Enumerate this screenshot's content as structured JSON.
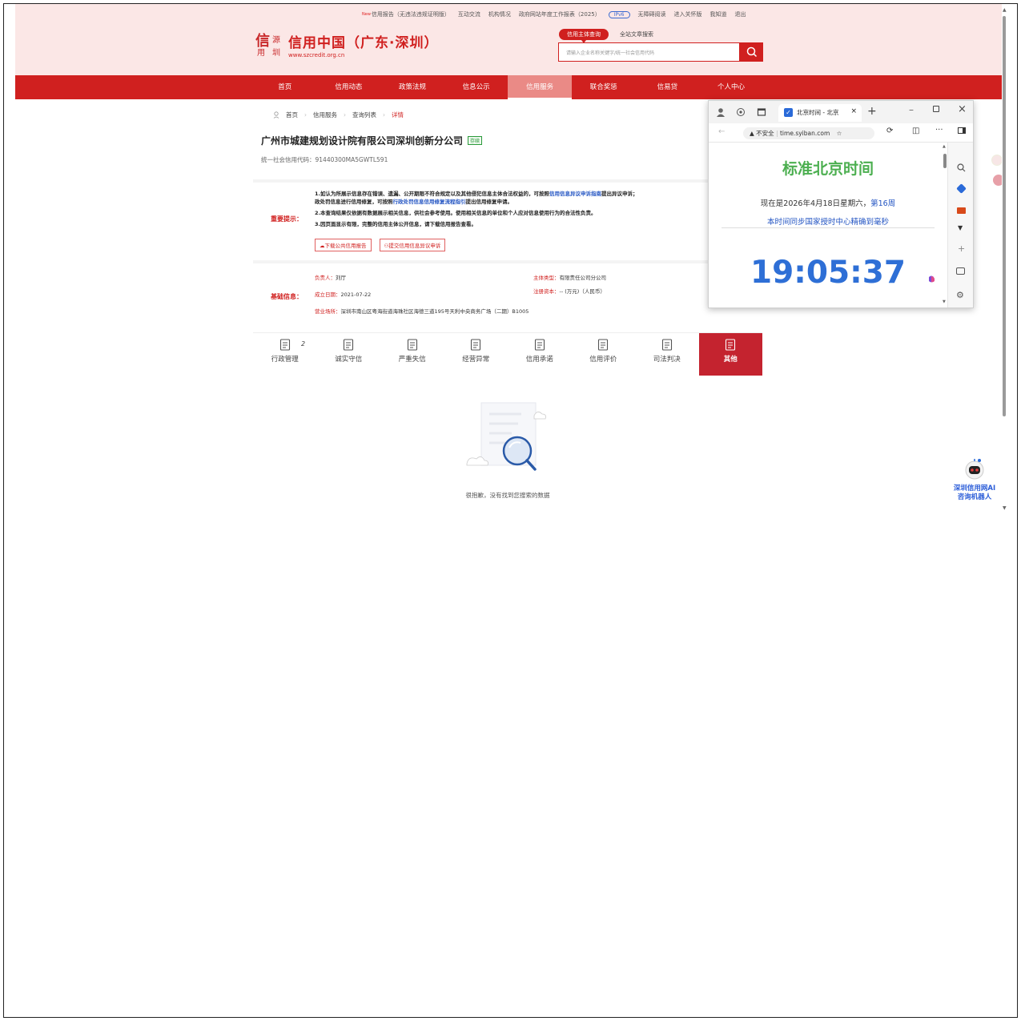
{
  "header": {
    "top_links": {
      "new_tag": "New",
      "report": "信用报告（无违法违规证明版）",
      "interact": "互动交流",
      "org": "机构情况",
      "gov_report": "政府网站年度工作报表（2025）",
      "ipv6": "IPv6",
      "barrier_free": "无障碍阅读",
      "elder": "进入关怀版",
      "login": "我知道",
      "exit": "退出"
    },
    "logo": {
      "mark_chars": [
        "信",
        "源",
        "用",
        "圳"
      ],
      "title": "信用中国（广东·深圳）",
      "url": "www.szcredit.org.cn"
    },
    "search": {
      "tab_active": "信用主体查询",
      "tab_other": "全站文章搜索",
      "placeholder": "请输入企业名称关键字/统一社会信用代码"
    }
  },
  "nav": {
    "items": [
      "首页",
      "信用动态",
      "政策法规",
      "信息公示",
      "信用服务",
      "联合奖惩",
      "信易贷",
      "个人中心"
    ],
    "active_index": 4
  },
  "breadcrumb": {
    "home": "首页",
    "service": "信用服务",
    "list": "查询列表",
    "current": "详情"
  },
  "company": {
    "name": "广州市城建规划设计院有限公司深圳创新分公司",
    "status": "存续",
    "uscc": "统一社会信用代码：91440300MA5GWTL591"
  },
  "notice": {
    "label": "重要提示：",
    "line1a": "1.如认为所展示信息存在错误、遗漏、公开期限不符合规定以及其他侵犯信息主体合法权益的，可按照",
    "line1_link": "信用信息异议申诉指南",
    "line1b": "提出异议申诉；",
    "line2a": "政处罚信息进行信用修复，可按照",
    "line2_link": "行政处罚信息信用修复流程指引",
    "line2b": "提出信用修复申请。",
    "line3": "2.本查询结果仅依据有数据展示相关信息，供社会参考使用。使用相关信息的单位和个人应对信息使用行为的合法性负责。",
    "line4": "3.因页面显示有限，完整的信用主体公开信息，请下载信用报告查看。",
    "btn_download": "下载公共信用报告",
    "btn_objection": "提交信用信息异议申诉"
  },
  "basic": {
    "label": "基础信息：",
    "leader_k": "负责人：",
    "leader_v": "刘厅",
    "type_k": "主体类型：",
    "type_v": "有限责任公司分公司",
    "date_k": "成立日期：",
    "date_v": "2021-07-22",
    "capital_k": "注册资本：",
    "capital_v": "-- (万元)（人民币）",
    "address_k": "营业场所：",
    "address_v": "深圳市南山区粤海街道海珠社区海德三道195号天利中央商务广场（二期）B1005"
  },
  "tabs": {
    "items": [
      "行政管理",
      "诚实守信",
      "严重失信",
      "经营异常",
      "信用承诺",
      "信用评价",
      "司法判决",
      "其他"
    ],
    "admin_count": "2",
    "active_index": 7
  },
  "empty": {
    "text": "很抱歉，没有找到您搜索的数据"
  },
  "popup": {
    "tab_title": "北京时间 - 北京",
    "insecure": "不安全",
    "url": "time.syiban.com",
    "page_title": "标准北京时间",
    "date_text": "现在是2026年4月18日星期六，",
    "week_text": "第16周",
    "sync_text": "本时间同步国家授时中心精确到毫秒",
    "clock": "19:05:37"
  },
  "robot": {
    "line1": "深圳信用网AI",
    "line2": "咨询机器人"
  },
  "colors": {
    "brand_red": "#d0201f",
    "header_bg": "#fbe7e6",
    "clock_blue": "#2e6fd6",
    "title_green": "#4caf50"
  }
}
